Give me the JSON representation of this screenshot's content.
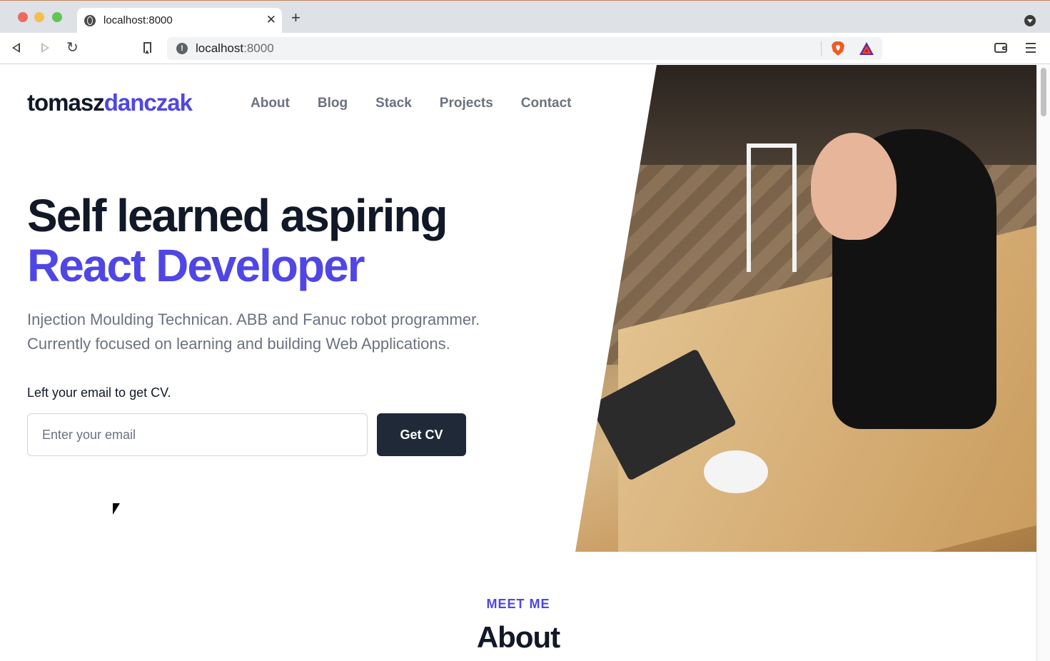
{
  "browser": {
    "tab_title": "localhost:8000",
    "close_glyph": "✕",
    "new_tab_glyph": "+",
    "url_host": "localhost",
    "url_port": ":8000",
    "reload_glyph": "↻"
  },
  "site": {
    "logo_first": "tomasz",
    "logo_second": "danczak",
    "nav": [
      "About",
      "Blog",
      "Stack",
      "Projects",
      "Contact"
    ],
    "headline_line1": "Self learned aspiring",
    "headline_line2": "React Developer",
    "lead_line1": "Injection Moulding Technican. ABB and Fanuc robot programmer.",
    "lead_line2": "Currently focused on learning and building Web Applications.",
    "email_label": "Left your email to get CV.",
    "email_placeholder": "Enter your email",
    "cv_button": "Get CV",
    "section_eyebrow": "MEET ME",
    "section_title": "About"
  },
  "colors": {
    "accent": "#4f46e5",
    "dark": "#111827",
    "button": "#1f2937",
    "muted": "#6b7280"
  },
  "icons": [
    "globe-icon",
    "back-icon",
    "forward-icon",
    "reload-icon",
    "bookmark-icon",
    "info-icon",
    "brave-shield-icon",
    "bat-rewards-icon",
    "wallet-icon",
    "menu-icon"
  ]
}
